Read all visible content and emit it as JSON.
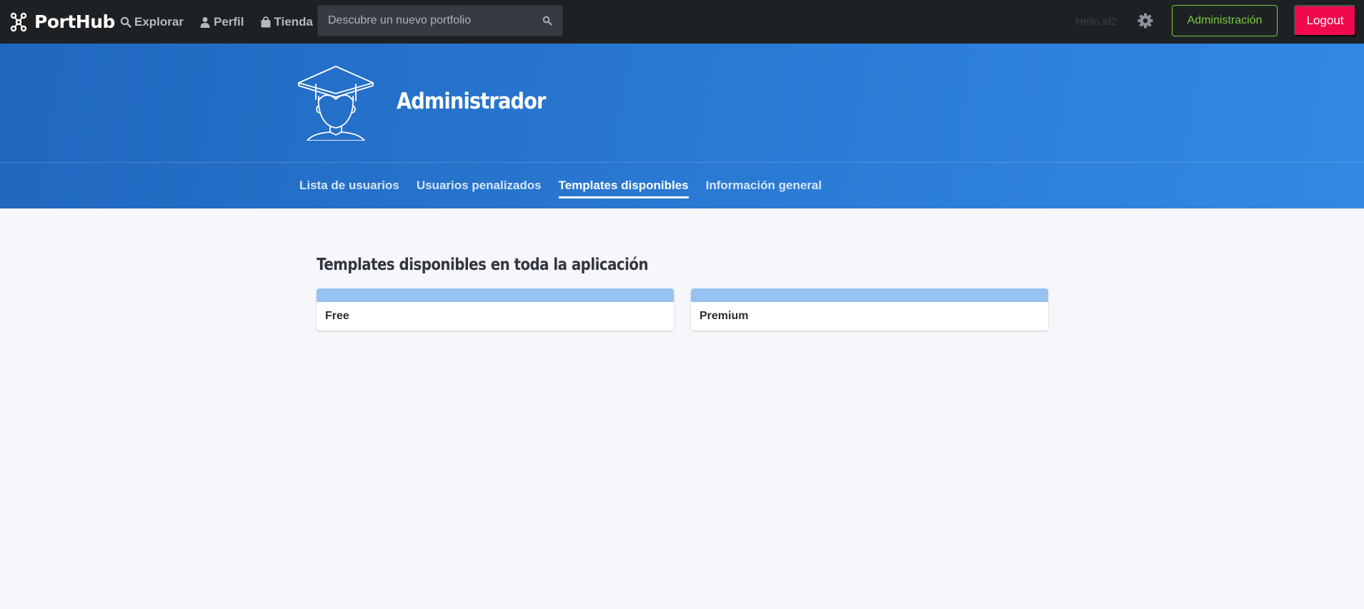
{
  "navbar": {
    "brand": "PortHub",
    "links": [
      {
        "label": "Explorar",
        "icon": "search-icon"
      },
      {
        "label": "Perfil",
        "icon": "user-icon"
      },
      {
        "label": "Tienda",
        "icon": "shopping-bag-icon"
      }
    ],
    "search_placeholder": "Descubre un nuevo portfolio",
    "greeting": "Hello,ld2",
    "admin_label": "Administración",
    "logout_label": "Logout"
  },
  "hero": {
    "title": "Administrador",
    "avatar_icon": "graduate-avatar-icon",
    "tabs": [
      {
        "label": "Lista de usuarios",
        "active": false
      },
      {
        "label": "Usuarios penalizados",
        "active": false
      },
      {
        "label": "Templates disponibles",
        "active": true
      },
      {
        "label": "Información general",
        "active": false
      }
    ]
  },
  "main": {
    "section_title": "Templates disponibles en toda la aplicación",
    "templates": [
      {
        "label": "Free"
      },
      {
        "label": "Premium"
      }
    ]
  },
  "colors": {
    "navbar_bg": "#1e2124",
    "hero_gradient_start": "#2067bf",
    "hero_gradient_end": "#3289e2",
    "admin_accent": "#78c93e",
    "logout_bg": "#f0094d",
    "card_banner": "#97c1ef",
    "page_bg": "#f5f7fa"
  }
}
